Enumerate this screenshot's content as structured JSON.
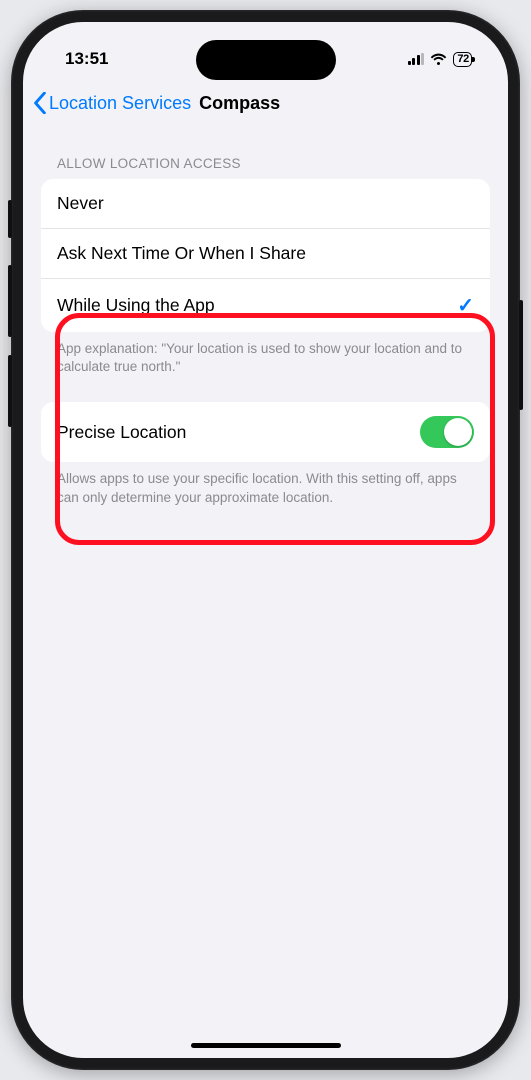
{
  "status": {
    "time": "13:51",
    "battery_pct": "72"
  },
  "nav": {
    "back_label": "Location Services",
    "title": "Compass"
  },
  "access_group": {
    "header": "ALLOW LOCATION ACCESS",
    "options": {
      "never": "Never",
      "ask": "Ask Next Time Or When I Share",
      "while": "While Using the App"
    },
    "selected": "while",
    "footer": "App explanation: \"Your location is used to show your location and to calculate true north.\""
  },
  "precise_group": {
    "label": "Precise Location",
    "enabled": true,
    "footer": "Allows apps to use your specific location. With this setting off, apps can only determine your approximate location."
  }
}
